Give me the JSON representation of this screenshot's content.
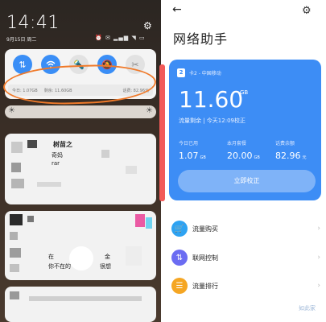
{
  "left": {
    "clock": "14:41",
    "date": "9月15日 周二",
    "status_icons": "⏰ ✉ ▂▄▆ ◥ ▭",
    "data_line": {
      "today": "今日: 1.07GB",
      "remaining": "剩余: 11.60GB",
      "balance": "话费: 82.96元"
    },
    "notif1": {
      "title": "树苗之",
      "line1": "奇妈",
      "line2": "rar"
    },
    "notif2": {
      "line1": "在",
      "line2": "你不在的",
      "line3": "很想",
      "suffix1": "金",
      "suffix2": "你"
    }
  },
  "right": {
    "title": "网络助手",
    "card": {
      "sim_badge": "2",
      "sim_label": "卡2 - 中国移动",
      "remaining_value": "11.60",
      "remaining_unit": "GB",
      "subtitle": "流量剩余 | 今天12:09校正",
      "stats": [
        {
          "label": "今日已用",
          "value": "1.07",
          "unit": "GB"
        },
        {
          "label": "本月套餐",
          "value": "20.00",
          "unit": "GB"
        },
        {
          "label": "话费余额",
          "value": "82.96",
          "unit": "元"
        }
      ],
      "calibrate_label": "立即校正"
    },
    "menu": [
      {
        "label": "流量购买",
        "color": "#2ea3f2",
        "icon": "cart-icon"
      },
      {
        "label": "联网控制",
        "color": "#6b6cf2",
        "icon": "arrows-icon"
      },
      {
        "label": "流量排行",
        "color": "#f5a623",
        "icon": "ranking-icon"
      }
    ],
    "watermark": "如此家"
  },
  "colors": {
    "accent": "#3d8df5",
    "highlight": "#f07a2a",
    "divider": "#f25a58"
  }
}
